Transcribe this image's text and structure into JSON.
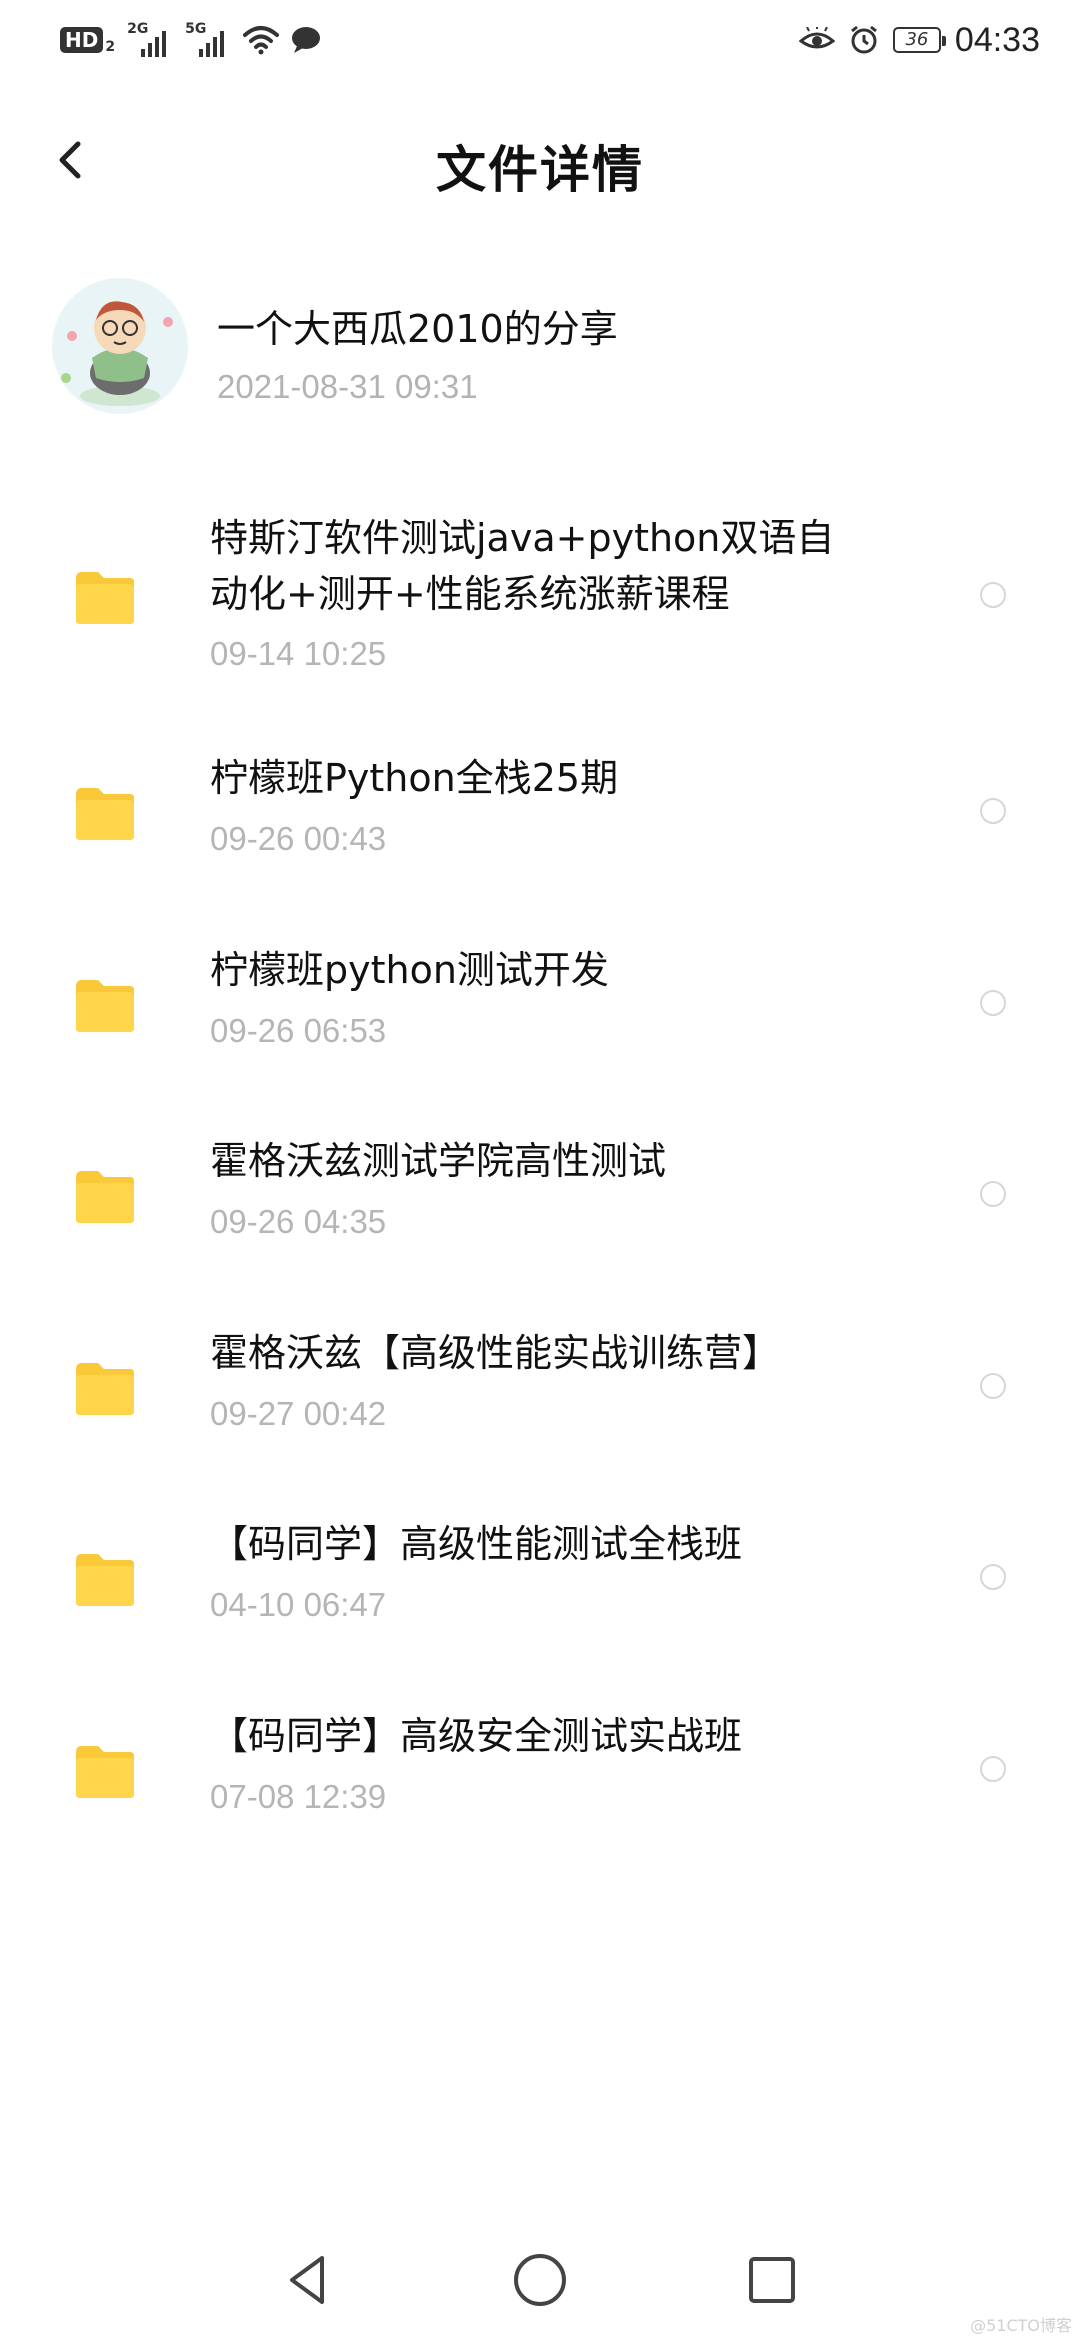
{
  "statusbar": {
    "hd": "HD",
    "hd_sub": "2",
    "net1": "2G",
    "net2": "5G",
    "battery": "36",
    "time": "04:33"
  },
  "header": {
    "title": "文件详情"
  },
  "sharer": {
    "name": "一个大西瓜2010的分享",
    "time": "2021-08-31  09:31"
  },
  "items": [
    {
      "title": "特斯汀软件测试java+python双语自动化+测开+性能系统涨薪课程",
      "time": "09-14  10:25"
    },
    {
      "title": "柠檬班Python全栈25期",
      "time": "09-26  00:43"
    },
    {
      "title": "柠檬班python测试开发",
      "time": "09-26  06:53"
    },
    {
      "title": "霍格沃兹测试学院高性测试",
      "time": "09-26  04:35"
    },
    {
      "title": "霍格沃兹【高级性能实战训练营】",
      "time": "09-27  00:42"
    },
    {
      "title": "【码同学】高级性能测试全栈班",
      "time": "04-10  06:47"
    },
    {
      "title": "【码同学】高级安全测试实战班",
      "time": "07-08  12:39"
    }
  ],
  "colors": {
    "folder": "#FFD54A",
    "folder_tab": "#F9C93A",
    "secondary_text": "#B5B5B5"
  },
  "watermark": "@51CTO博客"
}
